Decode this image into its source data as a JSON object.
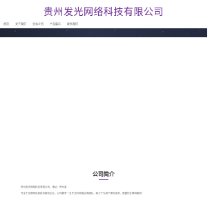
{
  "header": {
    "title": "贵州发光网络科技有限公司"
  },
  "nav": {
    "items": [
      {
        "label": "首页"
      },
      {
        "label": "关于我们"
      },
      {
        "label": "业务介绍"
      },
      {
        "label": "产品展示"
      },
      {
        "label": "联系我们"
      }
    ]
  },
  "about": {
    "heading": "公司简介",
    "line1": "贵州发光网络科技有限公司，地址：贵州省",
    "line2": "专注于互联网信息技术服务企业。公司拥有一支专业的网络技术团队，致力于为用户提供优质、便捷的互联网服务！"
  },
  "colors": {
    "brand": "#6a2c91",
    "banner": "#232a3f"
  }
}
